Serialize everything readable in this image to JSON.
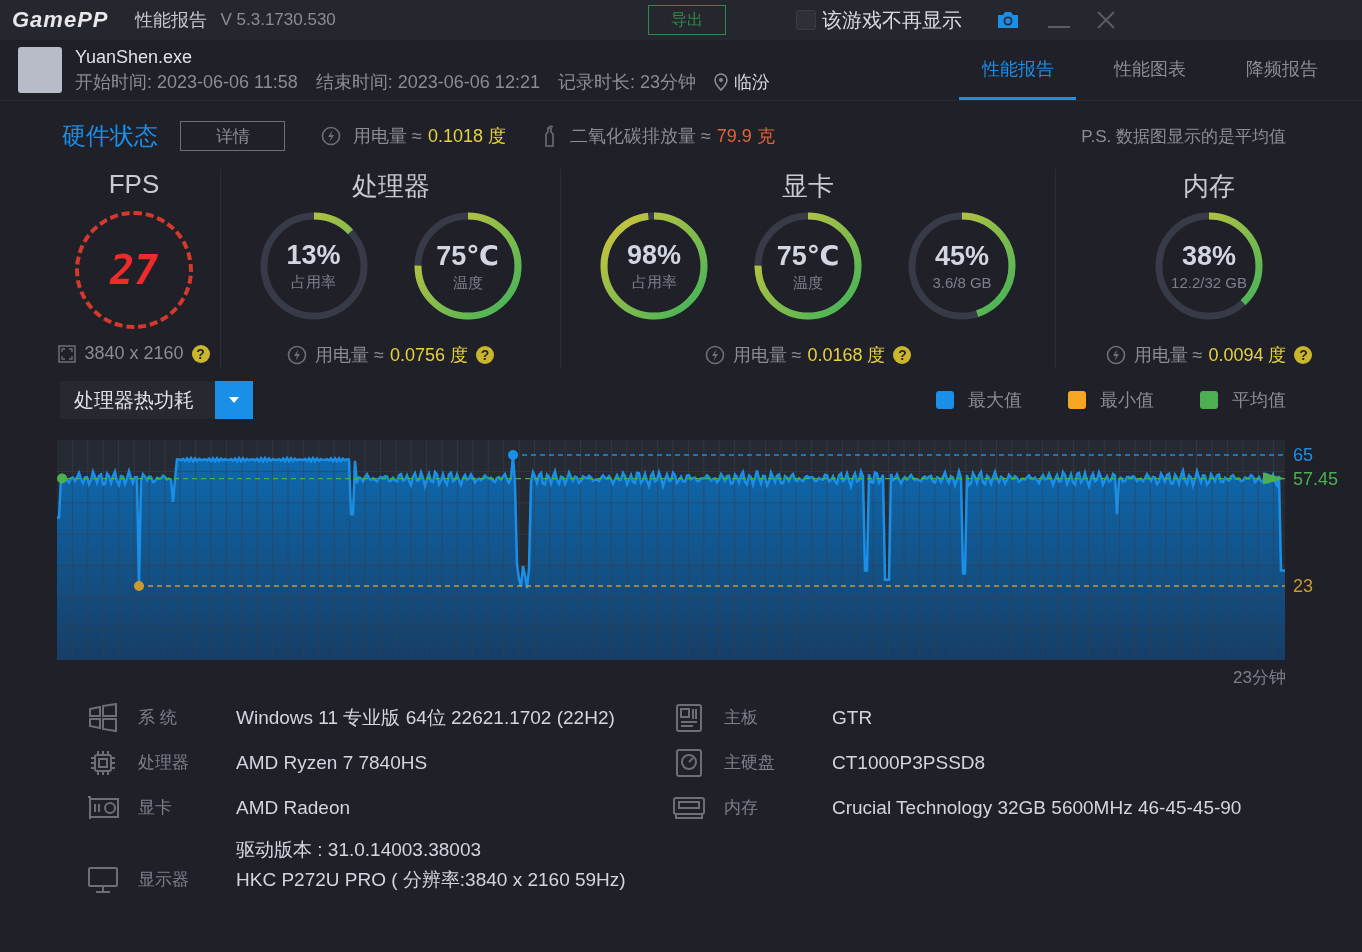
{
  "title_bar": {
    "logo": "GamePP",
    "title": "性能报告",
    "version": "V 5.3.1730.530",
    "export_button": "导出",
    "hide_checkbox": {
      "label": "该游戏不再显示",
      "checked": false
    }
  },
  "session": {
    "exe": "YuanShen.exe",
    "start": "开始时间: 2023-06-06 11:58",
    "end": "结束时间: 2023-06-06 12:21",
    "duration": "记录时长: 23分钟",
    "location": "临汾"
  },
  "tabs": [
    {
      "label": "性能报告",
      "selected": true
    },
    {
      "label": "性能图表",
      "selected": false
    },
    {
      "label": "降频报告",
      "selected": false
    }
  ],
  "hardware_status": {
    "title": "硬件状态",
    "details_button": "详情",
    "power_label": "用电量 ≈",
    "power_value": "0.1018 度",
    "co2_label": "二氧化碳排放量 ≈",
    "co2_value": "79.9 克",
    "note": "P.S. 数据图显示的是平均值"
  },
  "panels": [
    {
      "kind": "fps",
      "title": "FPS",
      "fps": "27",
      "resolution": "3840 x 2160",
      "help": "?"
    },
    {
      "kind": "gauges",
      "title": "处理器",
      "gauges": [
        {
          "value": "13%",
          "label": "占用率",
          "level": 0.13
        },
        {
          "value": "75℃",
          "label": "温度",
          "level": 0.75
        }
      ],
      "power_label": "用电量 ≈",
      "power_value": "0.0756 度",
      "help": "?"
    },
    {
      "kind": "gauges",
      "title": "显卡",
      "gauges": [
        {
          "value": "98%",
          "label": "占用率",
          "level": 0.98
        },
        {
          "value": "75℃",
          "label": "温度",
          "level": 0.75
        },
        {
          "value": "45%",
          "label": "3.6/8 GB",
          "level": 0.45
        }
      ],
      "power_label": "用电量 ≈",
      "power_value": "0.0168 度",
      "help": "?"
    },
    {
      "kind": "gauges",
      "title": "内存",
      "gauges": [
        {
          "value": "38%",
          "label": "12.2/32 GB",
          "level": 0.38
        }
      ],
      "power_label": "用电量 ≈",
      "power_value": "0.0094 度",
      "help": "?"
    }
  ],
  "chart": {
    "metric_dropdown": "处理器热功耗",
    "legend": [
      {
        "label": "最大值",
        "color": "#1a8fe8"
      },
      {
        "label": "最小值",
        "color": "#f5a623"
      },
      {
        "label": "平均值",
        "color": "#4caf50"
      }
    ],
    "markers": [
      {
        "value": "65",
        "color": "#1a8fe8"
      },
      {
        "value": "57.45",
        "color": "#4caf50"
      },
      {
        "value": "23",
        "color": "#c89a30"
      }
    ],
    "x_end_label": "23分钟"
  },
  "specs": [
    [
      {
        "kind": "os",
        "label": "系 统",
        "value": "Windows 11 专业版 64位 22621.1702 (22H2)"
      },
      {
        "kind": "cpu",
        "label": "处理器",
        "value": "AMD Ryzen 7 7840HS"
      },
      {
        "kind": "gpu",
        "label": "显卡",
        "value": "AMD Radeon",
        "extra": "驱动版本 : 31.0.14003.38003"
      },
      {
        "kind": "monitor",
        "label": "显示器",
        "value": "HKC P272U PRO ( 分辨率:3840 x 2160 59Hz)"
      }
    ],
    [
      {
        "kind": "board",
        "label": "主板",
        "value": "GTR"
      },
      {
        "kind": "disk",
        "label": "主硬盘",
        "value": "CT1000P3PSSD8"
      },
      {
        "kind": "ram",
        "label": "内存",
        "value": "Crucial Technology 32GB 5600MHz 46-45-45-90"
      }
    ]
  ]
}
